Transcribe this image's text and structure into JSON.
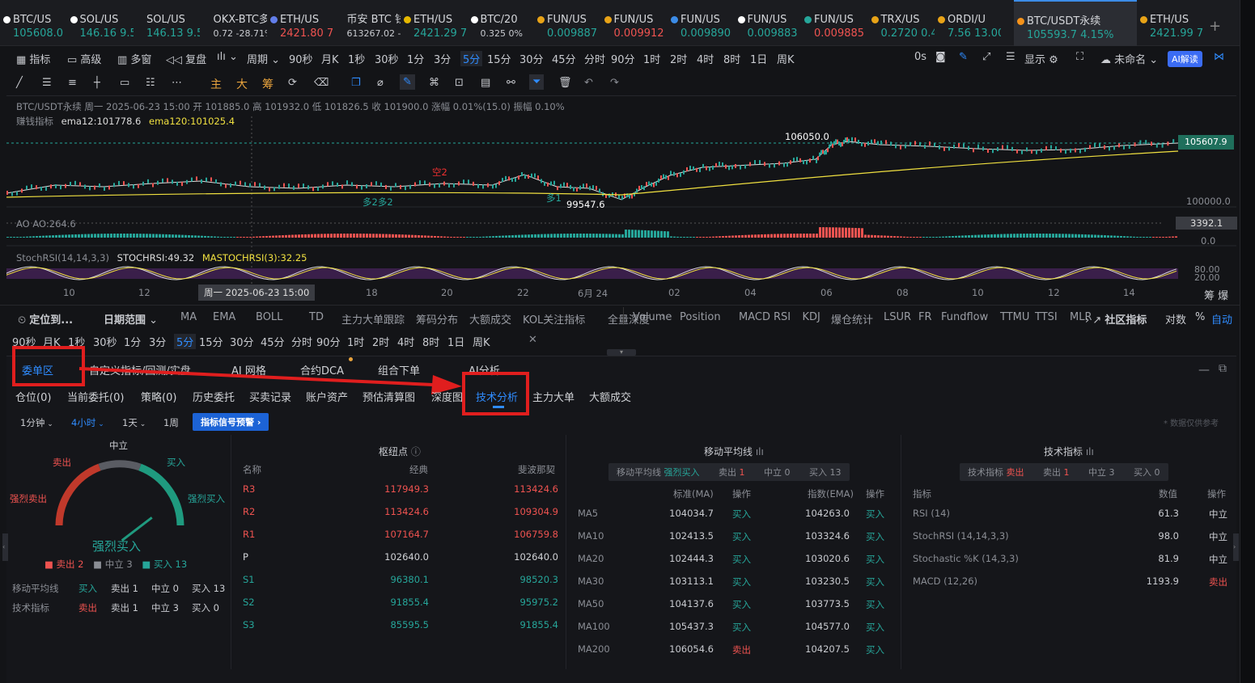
{
  "tickers": [
    {
      "name": "BTC/US",
      "price": "105608.0",
      "dir": "up",
      "icon": "x"
    },
    {
      "name": "SOL/US",
      "price": "146.16 9.5",
      "dir": "up",
      "icon": "x"
    },
    {
      "name": "SOL/US",
      "price": "146.13 9.5",
      "dir": "up",
      "icon": ""
    },
    {
      "name": "OKX-BTC多",
      "price": "0.72 -28.71%",
      "dir": "neutral",
      "icon": ""
    },
    {
      "name": "ETH/US",
      "price": "2421.80 7",
      "dir": "dn",
      "icon": "eth"
    },
    {
      "name": "币安 BTC 钱",
      "price": "613267.02 -(",
      "dir": "neutral",
      "icon": ""
    },
    {
      "name": "ETH/US",
      "price": "2421.29 7",
      "dir": "up",
      "icon": "up"
    },
    {
      "name": "BTC/20",
      "price": "0.325 0%",
      "dir": "neutral",
      "icon": "x"
    },
    {
      "name": "FUN/US",
      "price": "0.009887",
      "dir": "up",
      "icon": "fun"
    },
    {
      "name": "FUN/US",
      "price": "0.009912",
      "dir": "dn",
      "icon": "fun"
    },
    {
      "name": "FUN/US",
      "price": "0.009890",
      "dir": "up",
      "icon": "fun2"
    },
    {
      "name": "FUN/US",
      "price": "0.009883",
      "dir": "up",
      "icon": "fun3"
    },
    {
      "name": "FUN/US",
      "price": "0.009885",
      "dir": "dn",
      "icon": "fun4"
    },
    {
      "name": "TRX/US",
      "price": "0.2720 0.4",
      "dir": "up",
      "icon": "trx"
    },
    {
      "name": "ORDI/U",
      "price": "7.56 13.00",
      "dir": "up",
      "icon": "ordi"
    },
    {
      "name": "BTC/USDT永续",
      "price": "105593.7 4.15%",
      "dir": "up",
      "icon": "btc",
      "active": true
    },
    {
      "name": "ETH/US",
      "price": "2421.99 7",
      "dir": "up",
      "icon": "fun"
    }
  ],
  "toolbar1": {
    "indicator": "指标",
    "advanced": "高级",
    "multi": "多窗",
    "replay": "复盘",
    "period": "周期",
    "periods": [
      "90秒",
      "月K",
      "1秒",
      "30秒",
      "1分",
      "3分",
      "5分",
      "15分",
      "30分",
      "45分",
      "分时",
      "90分",
      "1时",
      "2时",
      "4时",
      "8时",
      "1日",
      "周K"
    ],
    "active_period": "5分",
    "right": {
      "zero": "0s",
      "display": "显示",
      "unnamed": "未命名",
      "ai": "AI解读"
    }
  },
  "toolbar2": {
    "labels": [
      "主",
      "大",
      "筹"
    ]
  },
  "chart": {
    "legend1": "BTC/USDT永续 周一 2025-06-23 15:00 开 101885.0 高 101932.0 低 101826.5 收 101900.0 涨幅 0.01%(15.0) 振幅 0.10%",
    "legend2_name": "赚钱指标",
    "ema12": "ema12:101778.6",
    "ema120": "ema120:101025.4",
    "high_label": "106050.0",
    "low_label": "99547.6",
    "price_now": "105607.9",
    "price_level": "100000.0",
    "marks": {
      "short": "空2",
      "long1": "多2多2",
      "long2": "多1"
    },
    "ao_label": "AO  AO:264.6",
    "ao_value": "3392.1",
    "ao_zero": "0.0",
    "stoch_label": "StochRSI(14,14,3,3)",
    "stoch_val": "STOCHRSI:49.32",
    "mastoch": "MASTOCHRSI(3):32.25",
    "stoch_80": "80.00",
    "stoch_20": "20.00",
    "xaxis": [
      "10",
      "12",
      "18",
      "20",
      "22",
      "6月 24",
      "02",
      "04",
      "06",
      "08",
      "10",
      "12",
      "14"
    ],
    "xaxis_hl": "周一 2025-06-23 15:00",
    "corner": "筹 爆"
  },
  "indicator_bar": {
    "locate": "定位到...",
    "range": "日期范围",
    "items": [
      "MA",
      "EMA",
      "BOLL",
      "TD",
      "主力大单跟踪",
      "筹码分布",
      "大额成交",
      "KOL关注指标",
      "全量深度"
    ],
    "items2": [
      "Volume",
      "Position",
      "MACD",
      "RSI",
      "KDJ",
      "爆仓统计",
      "LSUR",
      "FR",
      "Fundflow",
      "TTMU",
      "TTSI",
      "MLR"
    ],
    "community": "社区指标",
    "log": "对数",
    "pct": "%",
    "auto": "自动"
  },
  "period_bar": {
    "items": [
      "90秒",
      "月K",
      "1秒",
      "30秒",
      "1分",
      "3分",
      "5分",
      "15分",
      "30分",
      "45分",
      "分时",
      "90分",
      "1时",
      "2时",
      "4时",
      "8时",
      "1日",
      "周K"
    ],
    "active": "5分"
  },
  "panel_tabs": [
    "委单区",
    "自定义指标/回测/实盘",
    "AI 网格",
    "合约DCA",
    "组合下单",
    "AI分析"
  ],
  "sub_tabs": [
    "仓位(0)",
    "当前委托(0)",
    "策略(0)",
    "历史委托",
    "买卖记录",
    "账户资产",
    "预估清算图",
    "深度图",
    "技术分析",
    "主力大单",
    "大额成交"
  ],
  "time_filters": {
    "items": [
      "1分钟",
      "4小时",
      "1天",
      "1周"
    ],
    "active": "4小时",
    "signal": "指标信号预警"
  },
  "disclaimer": "* 数据仅供参考",
  "gauge": {
    "labels": {
      "neutral": "中立",
      "sell": "卖出",
      "buy": "买入",
      "strong_sell": "强烈卖出",
      "strong_buy": "强烈买入"
    },
    "result": "强烈买入",
    "legend": {
      "sell": "卖出 2",
      "neutral": "中立 3",
      "buy": "买入 13"
    },
    "needle_value": 0.85,
    "rows": [
      {
        "name": "移动平均线",
        "signal": "买入",
        "sell": "卖出 1",
        "neutral": "中立 0",
        "buy": "买入 13",
        "dir": "up"
      },
      {
        "name": "技术指标",
        "signal": "卖出",
        "sell": "卖出 1",
        "neutral": "中立 3",
        "buy": "买入 0",
        "dir": "dn"
      }
    ]
  },
  "pivot": {
    "title": "枢纽点",
    "cols": [
      "名称",
      "经典",
      "斐波那契"
    ],
    "rows": [
      {
        "n": "R3",
        "a": "117949.3",
        "b": "113424.6",
        "c": "dn"
      },
      {
        "n": "R2",
        "a": "113424.6",
        "b": "109304.9",
        "c": "dn"
      },
      {
        "n": "R1",
        "a": "107164.7",
        "b": "106759.8",
        "c": "dn"
      },
      {
        "n": "P",
        "a": "102640.0",
        "b": "102640.0",
        "c": "neu"
      },
      {
        "n": "S1",
        "a": "96380.1",
        "b": "98520.3",
        "c": "up"
      },
      {
        "n": "S2",
        "a": "91855.4",
        "b": "95975.2",
        "c": "up"
      },
      {
        "n": "S3",
        "a": "85595.5",
        "b": "91855.4",
        "c": "up"
      }
    ]
  },
  "ma": {
    "title": "移动平均线",
    "summary": {
      "label": "移动平均线",
      "signal": "强烈买入",
      "sell": "卖出",
      "sell_n": "1",
      "neutral": "中立 0",
      "buy": "买入 13"
    },
    "cols": [
      "标准(MA)",
      "操作",
      "指数(EMA)",
      "操作"
    ],
    "rows": [
      {
        "n": "MA5",
        "ma": "104034.7",
        "op1": "买入",
        "ema": "104263.0",
        "op2": "买入"
      },
      {
        "n": "MA10",
        "ma": "102413.5",
        "op1": "买入",
        "ema": "103324.6",
        "op2": "买入"
      },
      {
        "n": "MA20",
        "ma": "102444.3",
        "op1": "买入",
        "ema": "103020.6",
        "op2": "买入"
      },
      {
        "n": "MA30",
        "ma": "103113.1",
        "op1": "买入",
        "ema": "103230.5",
        "op2": "买入"
      },
      {
        "n": "MA50",
        "ma": "104137.6",
        "op1": "买入",
        "ema": "103773.5",
        "op2": "买入"
      },
      {
        "n": "MA100",
        "ma": "105437.3",
        "op1": "买入",
        "ema": "104577.0",
        "op2": "买入"
      },
      {
        "n": "MA200",
        "ma": "106054.6",
        "op1": "卖出",
        "ema": "104207.5",
        "op2": "买入"
      }
    ]
  },
  "tech": {
    "title": "技术指标",
    "summary": {
      "label": "技术指标",
      "signal": "卖出",
      "sell": "卖出",
      "sell_n": "1",
      "neutral": "中立 3",
      "buy": "买入 0"
    },
    "cols": [
      "指标",
      "数值",
      "操作"
    ],
    "rows": [
      {
        "n": "RSI (14)",
        "v": "61.3",
        "op": "中立"
      },
      {
        "n": "StochRSI (14,14,3,3)",
        "v": "98.0",
        "op": "中立"
      },
      {
        "n": "Stochastic %K (14,3,3)",
        "v": "81.9",
        "op": "中立"
      },
      {
        "n": "MACD (12,26)",
        "v": "1193.9",
        "op": "卖出"
      }
    ]
  },
  "colors": {
    "up": "#26a69a",
    "down": "#ef5350",
    "accent": "#2f8cff",
    "highlight": "#e01e1e"
  }
}
